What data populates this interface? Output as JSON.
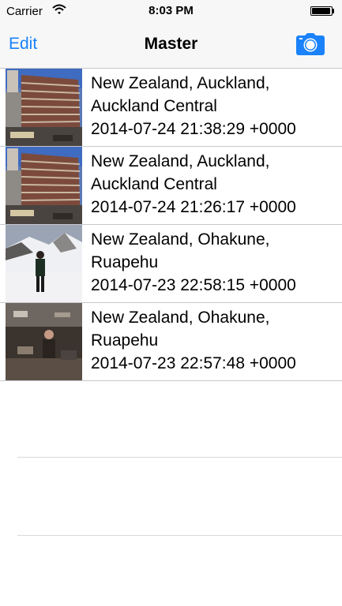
{
  "status_bar": {
    "carrier": "Carrier",
    "time": "8:03 PM"
  },
  "nav": {
    "edit_label": "Edit",
    "title": "Master",
    "camera_icon": "camera-icon",
    "accent_color": "#1a82fb"
  },
  "rows": [
    {
      "location_line1": "New Zealand, Auckland,",
      "location_line2": "Auckland Central",
      "timestamp": "2014-07-24 21:38:29 +0000",
      "thumbnail": "building-photo"
    },
    {
      "location_line1": "New Zealand, Auckland,",
      "location_line2": "Auckland Central",
      "timestamp": "2014-07-24 21:26:17 +0000",
      "thumbnail": "building-photo"
    },
    {
      "location_line1": "New Zealand, Ohakune,",
      "location_line2": "Ruapehu",
      "timestamp": "2014-07-23 22:58:15 +0000",
      "thumbnail": "snow-mountain-photo"
    },
    {
      "location_line1": "New Zealand, Ohakune,",
      "location_line2": "Ruapehu",
      "timestamp": "2014-07-23 22:57:48 +0000",
      "thumbnail": "indoor-person-photo"
    }
  ]
}
